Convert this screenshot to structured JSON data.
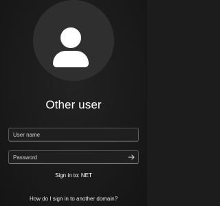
{
  "user": {
    "display_name": "Other user"
  },
  "form": {
    "username_placeholder": "User name",
    "password_placeholder": "Password",
    "username_value": "",
    "password_value": ""
  },
  "signin_target": "Sign in to: NET",
  "help_link": "How do I sign in to another domain?",
  "icons": {
    "avatar": "user-avatar-icon",
    "submit": "arrow-right-icon"
  },
  "colors": {
    "background": "#1c1c1c",
    "avatar_circle": "#2f2f2f",
    "text": "#ffffff"
  }
}
